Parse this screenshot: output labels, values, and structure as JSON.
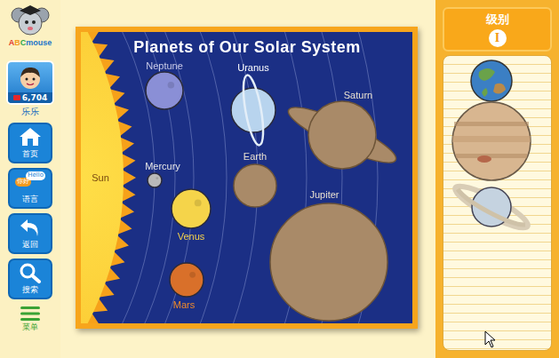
{
  "logo": "ABCmouse",
  "profile": {
    "tickets": "6,704",
    "name": "乐乐"
  },
  "nav": [
    {
      "label": "首页",
      "kind": "home"
    },
    {
      "label": "语言",
      "kind": "language",
      "bubbles": [
        "你好",
        "Hello"
      ]
    },
    {
      "label": "返回",
      "kind": "back"
    },
    {
      "label": "搜索",
      "kind": "search"
    }
  ],
  "menu": {
    "label": "菜单"
  },
  "game": {
    "title": "Planets of Our Solar System",
    "sun": "Sun",
    "planets": [
      {
        "name": "Neptune",
        "kind": "plain",
        "filled": true,
        "color": "#8a8fd6",
        "label_color": "#c9cbe8"
      },
      {
        "name": "Uranus",
        "kind": "ring-v",
        "filled": true,
        "color": "#b8d4ee",
        "label_color": "#ffffff"
      },
      {
        "name": "Saturn",
        "kind": "ring-h",
        "filled": false,
        "label_color": "#e8e0d0"
      },
      {
        "name": "Mercury",
        "kind": "plain",
        "filled": true,
        "color": "#b9b9b9",
        "label_color": "#e8e8e8"
      },
      {
        "name": "Earth",
        "kind": "plain",
        "filled": false,
        "label_color": "#e8e0d0"
      },
      {
        "name": "Venus",
        "kind": "plain",
        "filled": true,
        "color": "#f5d44a",
        "label_color": "#f7d34a"
      },
      {
        "name": "Jupiter",
        "kind": "plain",
        "filled": false,
        "label_color": "#e8e0d0"
      },
      {
        "name": "Mars",
        "kind": "plain",
        "filled": true,
        "color": "#d9702a",
        "label_color": "#f08a2a"
      }
    ]
  },
  "tray": {
    "level_label": "级别",
    "level": "I",
    "pieces": [
      {
        "kind": "earth",
        "color": "#3b7fc4"
      },
      {
        "kind": "jupiter",
        "color": "#d8b690"
      },
      {
        "kind": "saturn",
        "color": "#c5d3e0"
      }
    ]
  }
}
